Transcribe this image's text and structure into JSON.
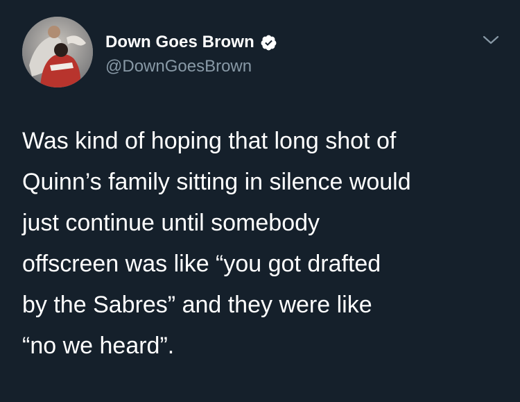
{
  "tweet": {
    "author": {
      "display_name": "Down Goes Brown",
      "handle": "@DownGoesBrown",
      "verified": true
    },
    "text": "Was kind of hoping that long shot of\nQuinn’s family sitting in silence would\njust continue until somebody\noffscreen was like “you got drafted\nby the Sabres” and they were like\n“no we heard”."
  },
  "icons": {
    "verified": "verified-badge-icon",
    "menu": "chevron-down-icon"
  },
  "colors": {
    "background": "#15202b",
    "primary_text": "#ffffff",
    "secondary_text": "#8899a6"
  }
}
